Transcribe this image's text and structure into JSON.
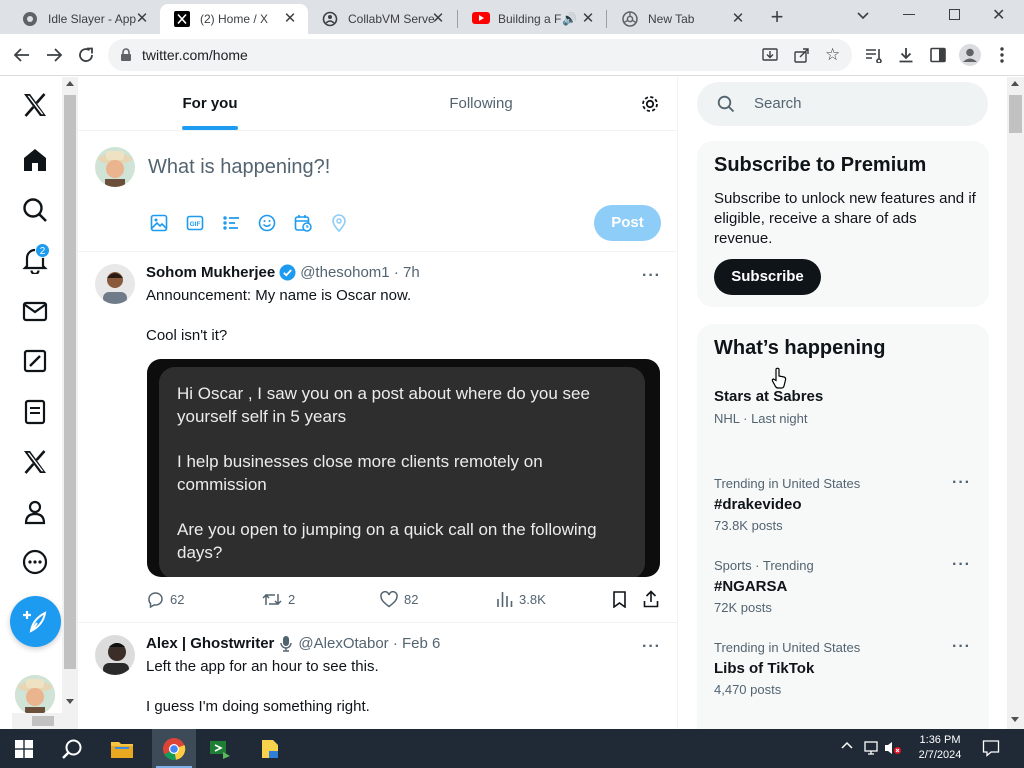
{
  "browser": {
    "tabs": [
      {
        "title": "Idle Slayer - App",
        "icon": "game-favicon"
      },
      {
        "title": "(2) Home / X",
        "icon": "x-favicon",
        "active": true
      },
      {
        "title": "CollabVM Serve",
        "icon": "collabvm-favicon"
      },
      {
        "title": "Building a F",
        "icon": "youtube-favicon"
      },
      {
        "title": "New Tab",
        "icon": "chrome-favicon"
      }
    ],
    "url": "twitter.com/home"
  },
  "nav": {
    "notification_badge": "2"
  },
  "feed": {
    "tabs": [
      "For you",
      "Following"
    ],
    "compose_placeholder": "What is happening?!",
    "post_button": "Post",
    "tweets": [
      {
        "name": "Sohom Mukherjee",
        "handle": "@thesohom1 · 7h",
        "lines": [
          "Announcement: My name is Oscar now.",
          "Cool isn't it?"
        ],
        "image_text": [
          "Hi Oscar  , I saw you on a post about where do you see",
          "yourself self in 5 years",
          "I help businesses close more clients remotely on",
          "commission",
          "Are you open to jumping on a quick call on the following",
          "days?"
        ],
        "replies": "62",
        "reposts": "2",
        "likes": "82",
        "views": "3.8K"
      },
      {
        "name": "Alex | Ghostwriter",
        "handle": "@AlexOtabor · Feb 6",
        "lines": [
          "Left the app for an hour to see this.",
          "I guess I'm doing something right."
        ]
      }
    ]
  },
  "sidebar": {
    "search_placeholder": "Search",
    "premium": {
      "title": "Subscribe to Premium",
      "body": "Subscribe to unlock new features and if eligible, receive a share of ads revenue.",
      "button": "Subscribe"
    },
    "happening": {
      "title": "What’s happening",
      "items": [
        {
          "name": "Stars at Sabres",
          "meta": "NHL · Last night"
        },
        {
          "meta": "Trending in United States",
          "name": "#drakevideo",
          "count": "73.8K posts"
        },
        {
          "meta": "Sports · Trending",
          "name": "#NGARSA",
          "count": "72K posts"
        },
        {
          "meta": "Trending in United States",
          "name": "Libs of TikTok",
          "count": "4,470 posts"
        }
      ]
    }
  },
  "taskbar": {
    "time": "1:36 PM",
    "date": "2/7/2024"
  },
  "colors": {
    "accent": "#1d9bf0",
    "post_disabled": "#8ecdf8",
    "taskbar": "#1f2a36"
  }
}
